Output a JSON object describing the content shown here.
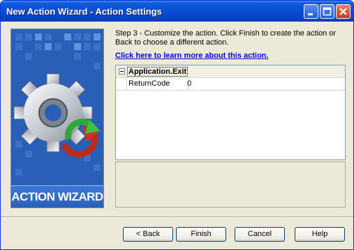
{
  "window": {
    "title": "New Action Wizard - Action Settings",
    "controls": {
      "minimize_icon": "minimize-icon",
      "maximize_icon": "maximize-icon",
      "close_icon": "close-icon"
    }
  },
  "banner": {
    "title": "ACTION WIZARD",
    "graphic": "gear-with-arrow-icon"
  },
  "content": {
    "step_text": "Step 3 - Customize the action.  Click Finish to create the action or Back to choose a different action.",
    "learn_more_link": "Click here to learn more about this action."
  },
  "property_grid": {
    "category": "Application.Exit",
    "expander_symbol": "−",
    "properties": [
      {
        "name": "ReturnCode",
        "value": "0"
      }
    ]
  },
  "buttons": {
    "back": "< Back",
    "finish": "Finish",
    "cancel": "Cancel",
    "help": "Help"
  },
  "colors": {
    "titlebar": "#0a4fd6",
    "banner": "#2a5fb8",
    "link": "#0000e0",
    "dialog_bg": "#ece9d8"
  }
}
